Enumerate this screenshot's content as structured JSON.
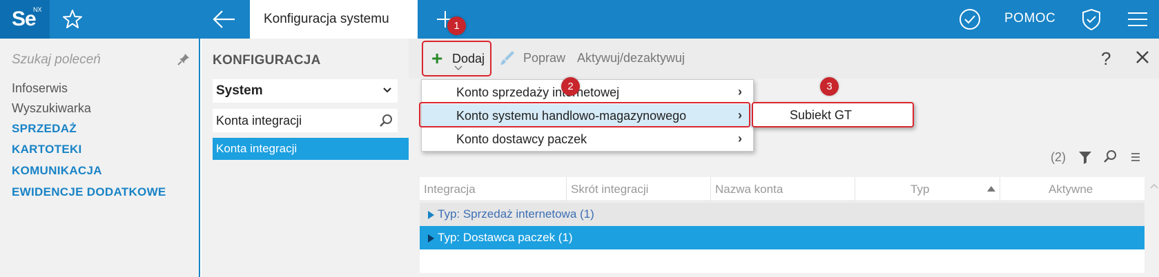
{
  "app": {
    "logo_text": "Se",
    "logo_superscript": "NX"
  },
  "topbar": {
    "active_tab": "Konfiguracja systemu",
    "help_label": "POMOC"
  },
  "sidebar": {
    "search_placeholder": "Szukaj poleceń",
    "items": [
      {
        "label": "Infoserwis",
        "type": "link"
      },
      {
        "label": "Wyszukiwarka",
        "type": "link"
      },
      {
        "label": "SPRZEDAŻ",
        "type": "section"
      },
      {
        "label": "KARTOTEKI",
        "type": "section"
      },
      {
        "label": "KOMUNIKACJA",
        "type": "section"
      },
      {
        "label": "EWIDENCJE DODATKOWE",
        "type": "section"
      }
    ]
  },
  "config": {
    "title": "KONFIGURACJA",
    "select_value": "System",
    "search_value": "Konta integracji",
    "selected_item": "Konta integracji"
  },
  "toolbar": {
    "add_label": "Dodaj",
    "edit_label": "Popraw",
    "toggle_label": "Aktywuj/dezaktywuj",
    "help_glyph": "?"
  },
  "add_menu": {
    "items": [
      {
        "label": "Konto sprzedaży internetowej",
        "arrow": "›"
      },
      {
        "label": "Konto systemu handlowo-magazynowego",
        "arrow": "›"
      },
      {
        "label": "Konto dostawcy paczek",
        "arrow": "›"
      }
    ],
    "submenu_item": "Subiekt GT"
  },
  "badges": [
    "1",
    "2",
    "3"
  ],
  "grid": {
    "count": "(2)",
    "columns": [
      "Integracja",
      "Skrót integracji",
      "Nazwa konta",
      "Typ",
      "Aktywne"
    ],
    "sorted_column": "Typ",
    "groups": [
      {
        "label": "Typ: Sprzedaż internetowa (1)"
      },
      {
        "label": "Typ: Dostawca paczek (1)"
      }
    ]
  },
  "colors": {
    "accent": "#1883c6",
    "selection": "#1ca0e0",
    "highlight_red": "#d9262e",
    "add_green": "#2a8a2a"
  }
}
